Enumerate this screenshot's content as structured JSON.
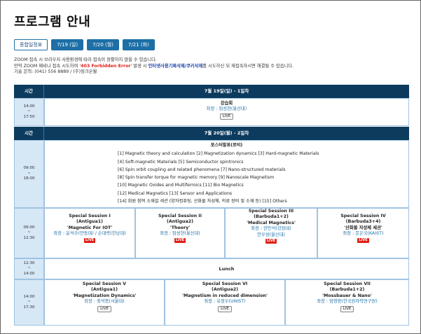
{
  "page": {
    "title": "프로그램 안내"
  },
  "tabs": [
    {
      "label": "종합일정표",
      "active": true
    },
    {
      "label": "7/19 (일)"
    },
    {
      "label": "7/20 (월)"
    },
    {
      "label": "7/21 (화)"
    }
  ],
  "notice": {
    "line1": "ZOOM 접속 시 브라우저 사용환경에 따라 접속이 원활하지 않을 수 있습니다.",
    "line2_a": "만약 ZOOM 웨비나 접속 시도하여 '",
    "line2_error": "403 Forbidden Error",
    "line2_b": "' 발생 시 ",
    "line2_action": "인터넷사용기록삭제/쿠키삭제",
    "line2_c": "를 시도하신 뒤 재접속하시면 해결될 수 있습니다.",
    "line3": "기술 문의: (041) 556 8889 / (주)링크온월"
  },
  "schedule": {
    "time_header": "시간",
    "day1": {
      "header": "7월 19일(일) - 1일차",
      "session": {
        "time_start": "14:00",
        "time_sep": "~",
        "time_end": "17:50",
        "title": "강습회",
        "chair": "좌장 : 임성현(울산대)",
        "button": "LIVE"
      }
    },
    "day2": {
      "header": "7월 20일(월) - 2일차",
      "poster": {
        "time_start": "09:00",
        "time_sep": "~",
        "time_end": "18:00",
        "title": "포스터발표(로비)",
        "items": [
          "[1] Magnetic theory and calculation [2] Magnetization dynamics [3] Hard-magnetic Materials",
          "[4] Soft-magnetic Materials [5] Semiconductor spintronics",
          "[6] Spin orbit coupling and related phenomena [7] Nano-structured materials",
          "[8] Spin transfer torque for magnetic memory [9] Nanoscale Magnetism",
          "[10] Magnetic Oxides and Multiferroics [11] Bio Magnetics",
          "[12] Medical Magnetics [13] Sensor and Applications",
          "[14] 회원 참여 소재설 세션 (양자컴퓨팅, 산화물 자성체, 의료 장비 및 소재 등) [15] Others"
        ]
      },
      "special_time": {
        "time_start": "09:00",
        "time_sep": "~",
        "time_end": "12:30"
      },
      "special_sessions": [
        {
          "name": "Special Session I",
          "room": "(Antigua1)",
          "topic": "'Magnetic For IOT'",
          "chair": "좌장 : 윤석수(안동대) / 손대락(한남대)",
          "live": "LIVE"
        },
        {
          "name": "Special Session II",
          "room": "(Antigua2)",
          "topic": "'Theory'",
          "chair": "좌장 : 임성현(울산대)",
          "live": "LIVE"
        },
        {
          "name": "Special Session III",
          "room": "(Barbuda1+2)",
          "topic": "'Medical Magnetics'",
          "chair": "좌장 : 한만석(강원대)",
          "chair2": "안우성(울산대)",
          "live": "LIVE"
        },
        {
          "name": "Special Session IV",
          "room": "(Barbuda3+4)",
          "topic": "'산화물 자성체 세션'",
          "chair": "좌장 : 문은국(KAIST)",
          "live": "LIVE"
        }
      ],
      "lunch": {
        "time_start": "12:30",
        "time_sep": "~",
        "time_end": "14:00",
        "label": "Lunch"
      },
      "afternoon_time": {
        "time_start": "14:00",
        "time_sep": "~",
        "time_end": "17:30"
      },
      "afternoon_sessions": [
        {
          "name": "Special Session V",
          "room": "(Antigua1)",
          "topic": "'Magnetization Dynamics'",
          "chair": "좌장 : 최석봉(서울대)",
          "button": "LIVE"
        },
        {
          "name": "Special Session VI",
          "room": "(Antigua2)",
          "topic": "'Magnetism in reduced dimension'",
          "chair": "좌장 : 유정우(UNIST)",
          "button": "LIVE"
        },
        {
          "name": "Special Session VII",
          "room": "(Barbuda1+2)",
          "topic": "'Mossbauer & Nano'",
          "chair": "좌장 : 엄영랑(한국원자력연구원)",
          "button": "LIVE"
        }
      ]
    }
  },
  "colors": {
    "header_bg": "#0c3b5e",
    "time_bg": "#d6e7f6",
    "tab_blue": "#1d6fa6",
    "live_red": "#e0201a",
    "chair_blue": "#1d6fa6"
  }
}
